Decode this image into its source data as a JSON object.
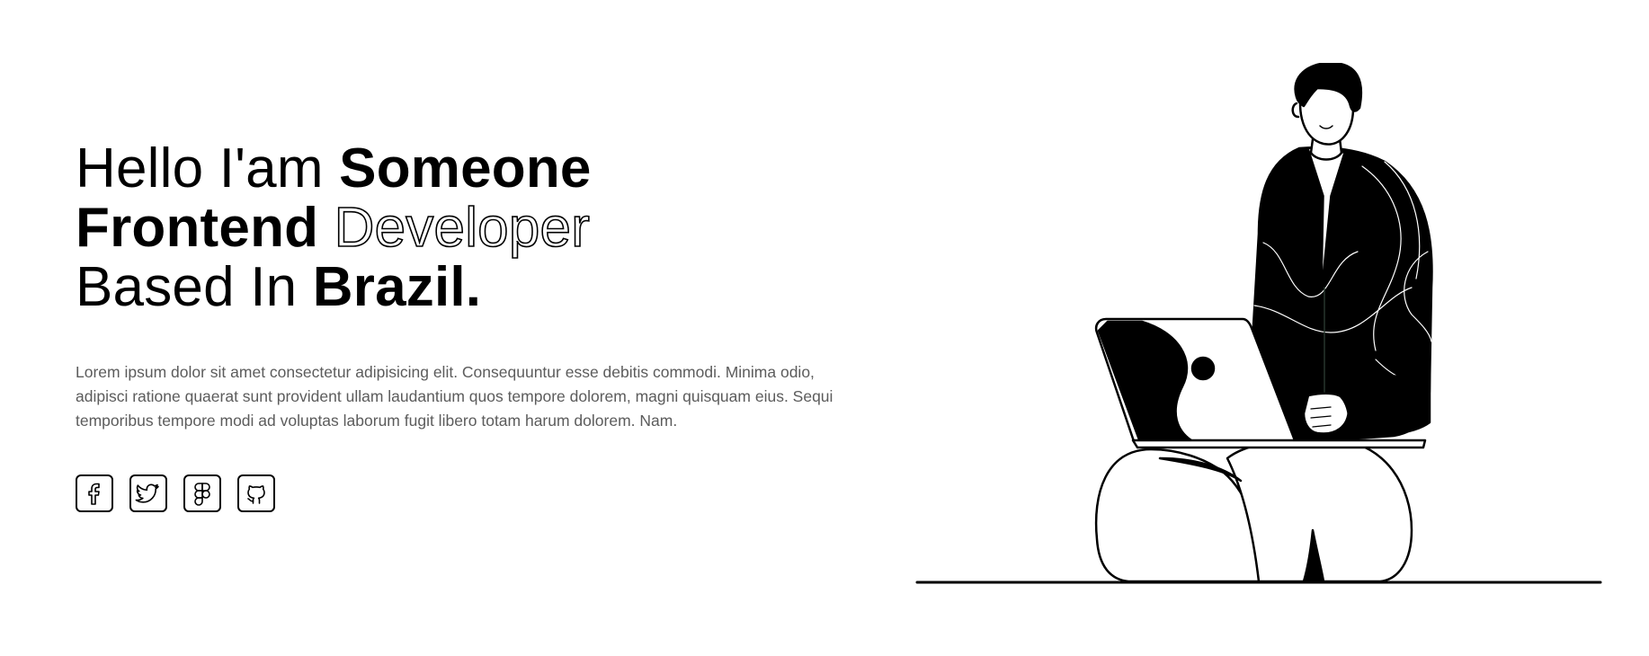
{
  "hero": {
    "headline": {
      "line1_regular": "Hello I'am ",
      "line1_bold": "Someone",
      "line2_bold": "Frontend ",
      "line2_outline": "Developer",
      "line3_regular": "Based In ",
      "line3_bold": "Brazil."
    },
    "description": "Lorem ipsum dolor sit amet consectetur adipisicing elit. Consequuntur esse debitis commodi. Minima odio, adipisci ratione quaerat sunt provident ullam laudantium quos tempore dolorem, magni quisquam eius. Sequi temporibus tempore modi ad voluptas laborum fugit libero totam harum dolorem. Nam."
  },
  "social_links": [
    {
      "name": "facebook",
      "icon": "facebook-icon"
    },
    {
      "name": "twitter",
      "icon": "twitter-icon"
    },
    {
      "name": "figma",
      "icon": "figma-icon"
    },
    {
      "name": "github",
      "icon": "github-icon"
    }
  ],
  "illustration": {
    "subject": "person-with-laptop-illustration"
  },
  "colors": {
    "text": "#000000",
    "muted_text": "#5c5c5c",
    "background": "#ffffff"
  }
}
